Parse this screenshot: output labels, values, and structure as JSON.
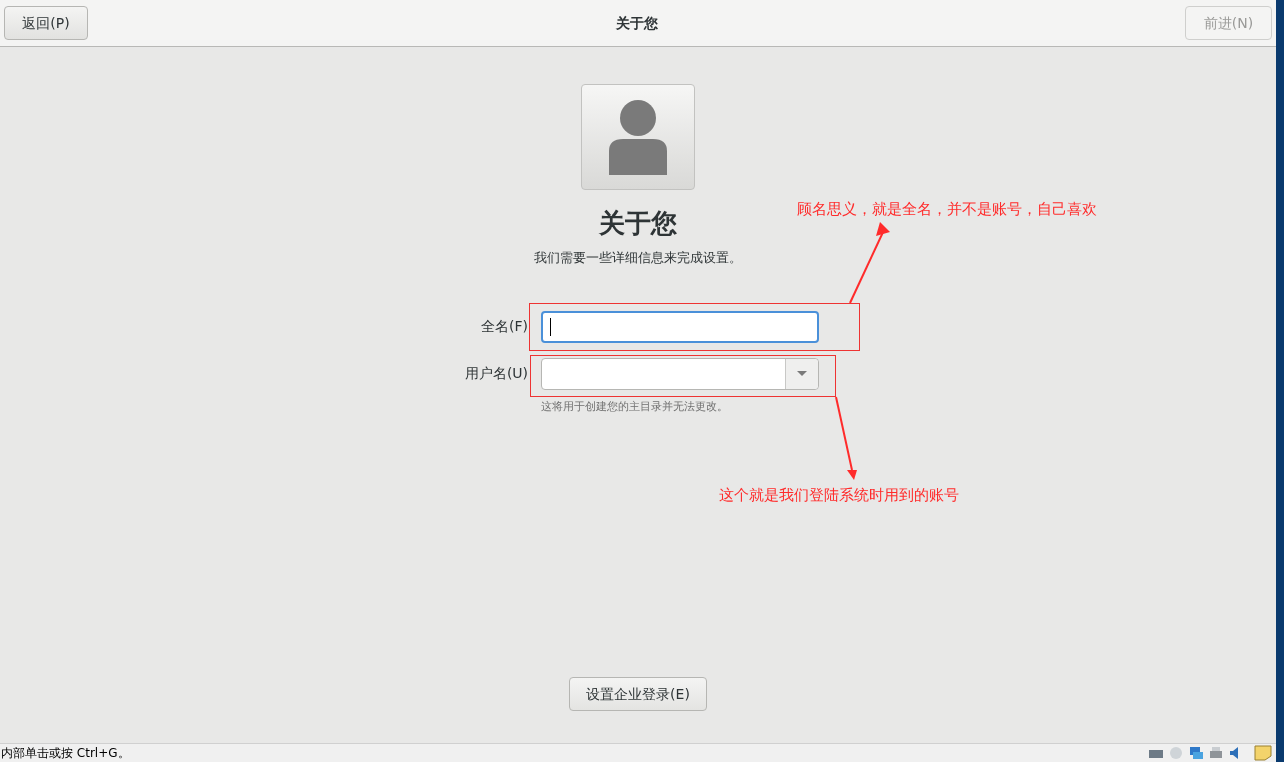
{
  "header": {
    "back_button": {
      "label": "返回(P)",
      "disabled": false
    },
    "title": "关于您",
    "next_button": {
      "label": "前进(N)",
      "disabled": true
    }
  },
  "heading": "关于您",
  "subtitle": "我们需要一些详细信息来完成设置。",
  "fields": [
    {
      "kind": "text",
      "label": "全名(F)",
      "focused": true
    },
    {
      "kind": "combo",
      "label": "用户名(U)",
      "focused": false,
      "hint": "这将用于创建您的主目录并无法更改。"
    }
  ],
  "enterprise_button": "设置企业登录(E)",
  "annotations": [
    {
      "text": "顾名思义，就是全名，并不是账号，自己喜欢"
    },
    {
      "text": "这个就是我们登陆系统时用到的账号"
    }
  ],
  "status_bar": {
    "text": "内部单击或按 Ctrl+G。"
  }
}
